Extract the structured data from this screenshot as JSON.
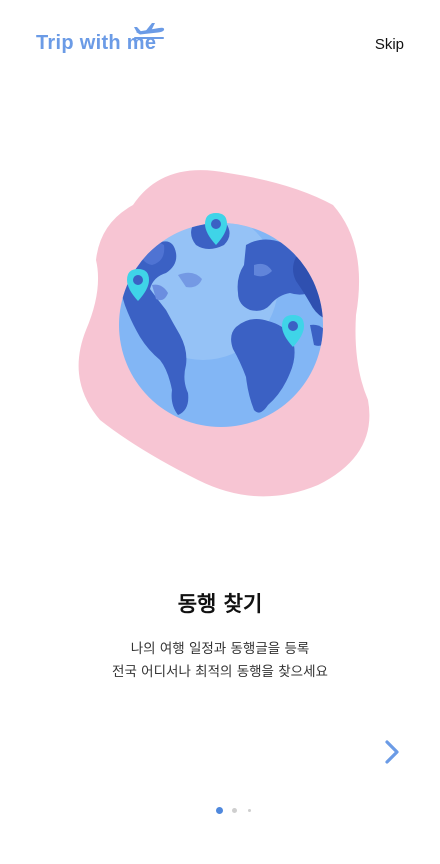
{
  "header": {
    "logo_text": "Trip with me",
    "skip_label": "Skip"
  },
  "slide": {
    "title": "동행 찾기",
    "description_line1": "나의 여행 일정과 동행글을 등록",
    "description_line2": "전국 어디서나 최적의 동행을 찾으세요"
  },
  "pagination": {
    "total": 3,
    "current": 1
  },
  "colors": {
    "brand": "#6b9be6",
    "blob": "#f7c5d3",
    "ocean": "#82b6f5",
    "land": "#3b61c4",
    "pin": "#3fd4e8"
  },
  "icons": {
    "plane": "airplane-icon",
    "next": "chevron-right-icon",
    "pin": "map-pin-icon"
  }
}
